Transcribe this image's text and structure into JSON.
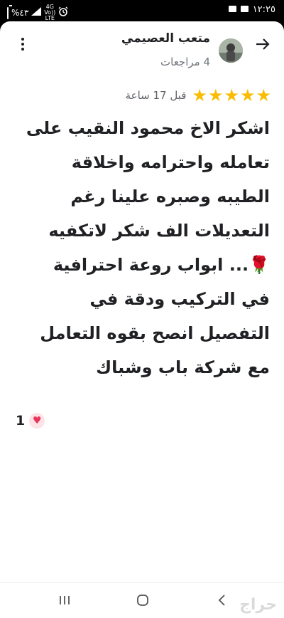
{
  "status_bar": {
    "time": "١٢:٢٥",
    "battery_percent": "%٤٣",
    "network_top": "4G",
    "network_mid": "Vo))",
    "network_bottom": "LTE",
    "icons": [
      "battery-icon",
      "signal-icon",
      "network-icon",
      "alarm-icon",
      "image-notification-icon",
      "message-notification-icon"
    ]
  },
  "review": {
    "reviewer_name": "متعب العصيمي",
    "review_count": "4 مراجعات",
    "rating": 5,
    "time_ago": "قبل 17 ساعة",
    "text": "اشكر الاخ محمود النقيب على\nتعامله واحترامه واخلاقة\nالطيبه وصبره علينا رغم\nالتعديلات  الف شكر لاتكفيه\n🌹... ابواب روعة احترافية\nفي التركيب ودقة في\nالتفصيل انصح بقوه التعامل\nمع شركة باب وشباك",
    "likes": "1"
  },
  "watermark": "حراج",
  "colors": {
    "star": "#fbbc04",
    "heart": "#e8345a",
    "text": "#202124",
    "secondary": "#70757a"
  }
}
